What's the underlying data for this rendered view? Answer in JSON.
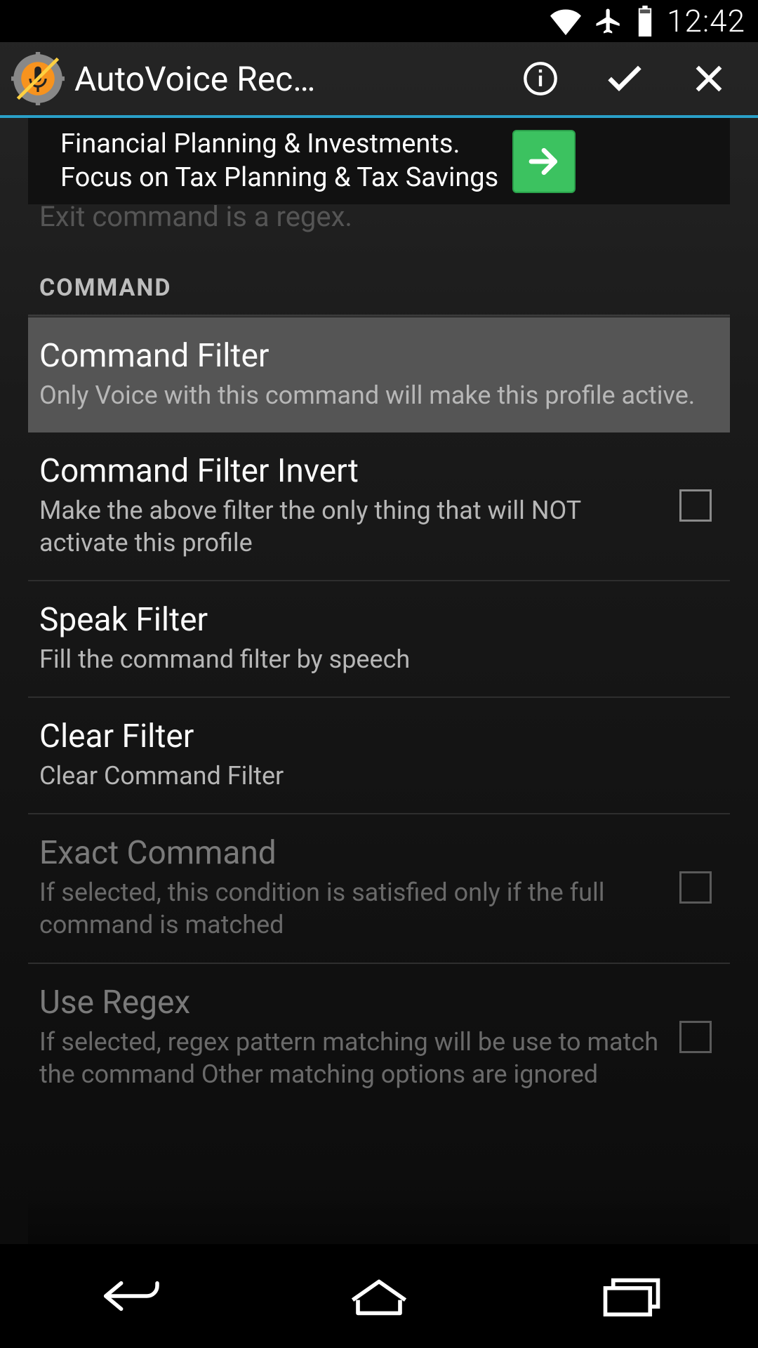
{
  "status": {
    "time": "12:42"
  },
  "appbar": {
    "title": "AutoVoice Rec…"
  },
  "ad": {
    "line1": "Financial Planning & Investments.",
    "line2": "Focus on Tax Planning & Tax Savings"
  },
  "hidden_prev": "Exit command is a regex.",
  "section": {
    "command": "COMMAND"
  },
  "rows": {
    "command_filter": {
      "title": "Command Filter",
      "sub": "Only Voice with this command will make this profile active."
    },
    "command_filter_invert": {
      "title": "Command Filter Invert",
      "sub": "Make the above filter the only thing that will NOT activate this profile"
    },
    "speak_filter": {
      "title": "Speak Filter",
      "sub": "Fill the command filter by speech"
    },
    "clear_filter": {
      "title": "Clear Filter",
      "sub": "Clear Command Filter"
    },
    "exact_command": {
      "title": "Exact Command",
      "sub": "If selected, this condition is satisfied only if the full command is matched"
    },
    "use_regex": {
      "title": "Use Regex",
      "sub": "If selected, regex pattern matching will be use to match the command Other matching options are ignored"
    }
  }
}
